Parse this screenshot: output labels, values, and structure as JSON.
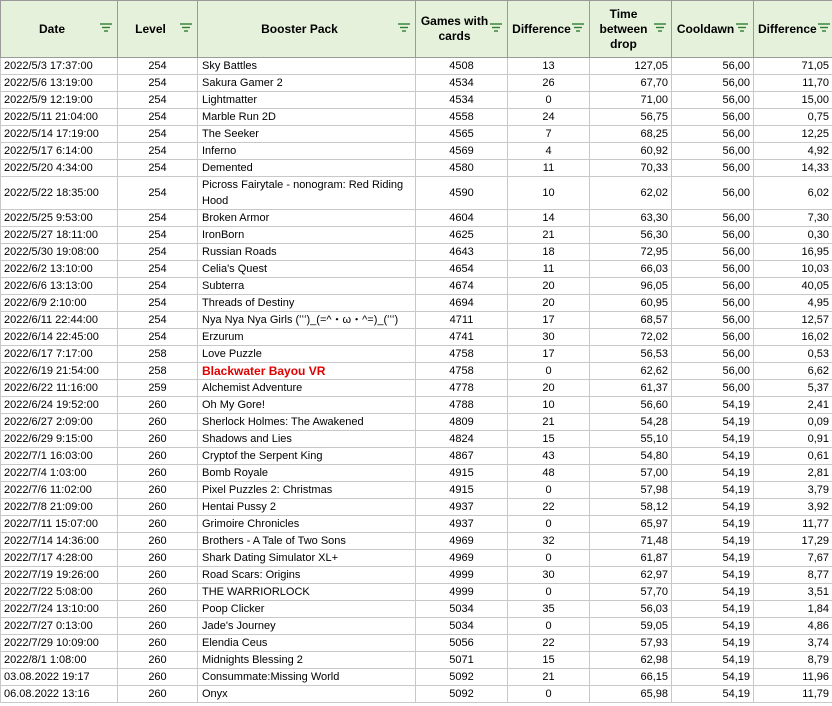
{
  "colors": {
    "header_bg": "#e6f1dc",
    "filter_icon": "#2e7d32",
    "highlight_text": "#e00000",
    "grid": "#c8c8c8"
  },
  "headers": {
    "date": "Date",
    "level": "Level",
    "pack": "Booster Pack",
    "games": "Games with cards",
    "diff1": "Difference",
    "time": "Time between drop",
    "cooldown": "Cooldawn",
    "diff2": "Difference"
  },
  "rows": [
    {
      "date": "2022/5/3 17:37:00",
      "level": "254",
      "pack": "Sky Battles",
      "games": "4508",
      "diff1": "13",
      "time": "127,05",
      "cooldown": "56,00",
      "diff2": "71,05"
    },
    {
      "date": "2022/5/6 13:19:00",
      "level": "254",
      "pack": "Sakura Gamer 2",
      "games": "4534",
      "diff1": "26",
      "time": "67,70",
      "cooldown": "56,00",
      "diff2": "11,70"
    },
    {
      "date": "2022/5/9 12:19:00",
      "level": "254",
      "pack": "Lightmatter",
      "games": "4534",
      "diff1": "0",
      "time": "71,00",
      "cooldown": "56,00",
      "diff2": "15,00"
    },
    {
      "date": "2022/5/11 21:04:00",
      "level": "254",
      "pack": "Marble Run 2D",
      "games": "4558",
      "diff1": "24",
      "time": "56,75",
      "cooldown": "56,00",
      "diff2": "0,75"
    },
    {
      "date": "2022/5/14 17:19:00",
      "level": "254",
      "pack": "The Seeker",
      "games": "4565",
      "diff1": "7",
      "time": "68,25",
      "cooldown": "56,00",
      "diff2": "12,25"
    },
    {
      "date": "2022/5/17 6:14:00",
      "level": "254",
      "pack": "Inferno",
      "games": "4569",
      "diff1": "4",
      "time": "60,92",
      "cooldown": "56,00",
      "diff2": "4,92"
    },
    {
      "date": "2022/5/20 4:34:00",
      "level": "254",
      "pack": "Demented",
      "games": "4580",
      "diff1": "11",
      "time": "70,33",
      "cooldown": "56,00",
      "diff2": "14,33"
    },
    {
      "date": "2022/5/22 18:35:00",
      "level": "254",
      "pack": "Picross Fairytale - nonogram: Red Riding Hood",
      "games": "4590",
      "diff1": "10",
      "time": "62,02",
      "cooldown": "56,00",
      "diff2": "6,02",
      "tall": true
    },
    {
      "date": "2022/5/25 9:53:00",
      "level": "254",
      "pack": "Broken Armor",
      "games": "4604",
      "diff1": "14",
      "time": "63,30",
      "cooldown": "56,00",
      "diff2": "7,30"
    },
    {
      "date": "2022/5/27 18:11:00",
      "level": "254",
      "pack": "IronBorn",
      "games": "4625",
      "diff1": "21",
      "time": "56,30",
      "cooldown": "56,00",
      "diff2": "0,30"
    },
    {
      "date": "2022/5/30 19:08:00",
      "level": "254",
      "pack": "Russian Roads",
      "games": "4643",
      "diff1": "18",
      "time": "72,95",
      "cooldown": "56,00",
      "diff2": "16,95"
    },
    {
      "date": "2022/6/2 13:10:00",
      "level": "254",
      "pack": "Celia's Quest",
      "games": "4654",
      "diff1": "11",
      "time": "66,03",
      "cooldown": "56,00",
      "diff2": "10,03"
    },
    {
      "date": "2022/6/6 13:13:00",
      "level": "254",
      "pack": "Subterra",
      "games": "4674",
      "diff1": "20",
      "time": "96,05",
      "cooldown": "56,00",
      "diff2": "40,05"
    },
    {
      "date": "2022/6/9 2:10:00",
      "level": "254",
      "pack": "Threads of Destiny",
      "games": "4694",
      "diff1": "20",
      "time": "60,95",
      "cooldown": "56,00",
      "diff2": "4,95"
    },
    {
      "date": "2022/6/11 22:44:00",
      "level": "254",
      "pack": "Nya Nya Nya Girls (ʻʻʻ)_(=^・ω・^=)_(ʻʻʻ)",
      "games": "4711",
      "diff1": "17",
      "time": "68,57",
      "cooldown": "56,00",
      "diff2": "12,57"
    },
    {
      "date": "2022/6/14 22:45:00",
      "level": "254",
      "pack": "Erzurum",
      "games": "4741",
      "diff1": "30",
      "time": "72,02",
      "cooldown": "56,00",
      "diff2": "16,02"
    },
    {
      "date": "2022/6/17 7:17:00",
      "level": "258",
      "pack": "Love Puzzle",
      "games": "4758",
      "diff1": "17",
      "time": "56,53",
      "cooldown": "56,00",
      "diff2": "0,53"
    },
    {
      "date": "2022/6/19 21:54:00",
      "level": "258",
      "pack": "Blackwater Bayou VR",
      "games": "4758",
      "diff1": "0",
      "time": "62,62",
      "cooldown": "56,00",
      "diff2": "6,62",
      "highlight": true
    },
    {
      "date": "2022/6/22 11:16:00",
      "level": "259",
      "pack": "Alchemist Adventure",
      "games": "4778",
      "diff1": "20",
      "time": "61,37",
      "cooldown": "56,00",
      "diff2": "5,37"
    },
    {
      "date": "2022/6/24 19:52:00",
      "level": "260",
      "pack": "Oh My Gore!",
      "games": "4788",
      "diff1": "10",
      "time": "56,60",
      "cooldown": "54,19",
      "diff2": "2,41"
    },
    {
      "date": "2022/6/27 2:09:00",
      "level": "260",
      "pack": "Sherlock Holmes: The Awakened",
      "games": "4809",
      "diff1": "21",
      "time": "54,28",
      "cooldown": "54,19",
      "diff2": "0,09"
    },
    {
      "date": "2022/6/29 9:15:00",
      "level": "260",
      "pack": "Shadows and Lies",
      "games": "4824",
      "diff1": "15",
      "time": "55,10",
      "cooldown": "54,19",
      "diff2": "0,91"
    },
    {
      "date": "2022/7/1 16:03:00",
      "level": "260",
      "pack": "Cryptof the Serpent King",
      "games": "4867",
      "diff1": "43",
      "time": "54,80",
      "cooldown": "54,19",
      "diff2": "0,61"
    },
    {
      "date": "2022/7/4 1:03:00",
      "level": "260",
      "pack": "Bomb Royale",
      "games": "4915",
      "diff1": "48",
      "time": "57,00",
      "cooldown": "54,19",
      "diff2": "2,81"
    },
    {
      "date": "2022/7/6 11:02:00",
      "level": "260",
      "pack": "Pixel Puzzles 2: Christmas",
      "games": "4915",
      "diff1": "0",
      "time": "57,98",
      "cooldown": "54,19",
      "diff2": "3,79"
    },
    {
      "date": "2022/7/8 21:09:00",
      "level": "260",
      "pack": "Hentai Pussy 2",
      "games": "4937",
      "diff1": "22",
      "time": "58,12",
      "cooldown": "54,19",
      "diff2": "3,92"
    },
    {
      "date": "2022/7/11 15:07:00",
      "level": "260",
      "pack": "Grimoire Chronicles",
      "games": "4937",
      "diff1": "0",
      "time": "65,97",
      "cooldown": "54,19",
      "diff2": "11,77"
    },
    {
      "date": "2022/7/14 14:36:00",
      "level": "260",
      "pack": "Brothers - A Tale of Two Sons",
      "games": "4969",
      "diff1": "32",
      "time": "71,48",
      "cooldown": "54,19",
      "diff2": "17,29"
    },
    {
      "date": "2022/7/17 4:28:00",
      "level": "260",
      "pack": "Shark Dating Simulator XL+",
      "games": "4969",
      "diff1": "0",
      "time": "61,87",
      "cooldown": "54,19",
      "diff2": "7,67"
    },
    {
      "date": "2022/7/19 19:26:00",
      "level": "260",
      "pack": "Road Scars: Origins",
      "games": "4999",
      "diff1": "30",
      "time": "62,97",
      "cooldown": "54,19",
      "diff2": "8,77"
    },
    {
      "date": "2022/7/22 5:08:00",
      "level": "260",
      "pack": "THE WARRIORLOCK",
      "games": "4999",
      "diff1": "0",
      "time": "57,70",
      "cooldown": "54,19",
      "diff2": "3,51"
    },
    {
      "date": "2022/7/24 13:10:00",
      "level": "260",
      "pack": "Poop Clicker",
      "games": "5034",
      "diff1": "35",
      "time": "56,03",
      "cooldown": "54,19",
      "diff2": "1,84"
    },
    {
      "date": "2022/7/27 0:13:00",
      "level": "260",
      "pack": "Jade's Journey",
      "games": "5034",
      "diff1": "0",
      "time": "59,05",
      "cooldown": "54,19",
      "diff2": "4,86"
    },
    {
      "date": "2022/7/29 10:09:00",
      "level": "260",
      "pack": "Elendia Ceus",
      "games": "5056",
      "diff1": "22",
      "time": "57,93",
      "cooldown": "54,19",
      "diff2": "3,74"
    },
    {
      "date": "2022/8/1 1:08:00",
      "level": "260",
      "pack": "Midnights Blessing 2",
      "games": "5071",
      "diff1": "15",
      "time": "62,98",
      "cooldown": "54,19",
      "diff2": "8,79"
    },
    {
      "date": "03.08.2022 19:17",
      "level": "260",
      "pack": "Consummate:Missing World",
      "games": "5092",
      "diff1": "21",
      "time": "66,15",
      "cooldown": "54,19",
      "diff2": "11,96"
    },
    {
      "date": "06.08.2022 13:16",
      "level": "260",
      "pack": "Onyx",
      "games": "5092",
      "diff1": "0",
      "time": "65,98",
      "cooldown": "54,19",
      "diff2": "11,79"
    }
  ]
}
